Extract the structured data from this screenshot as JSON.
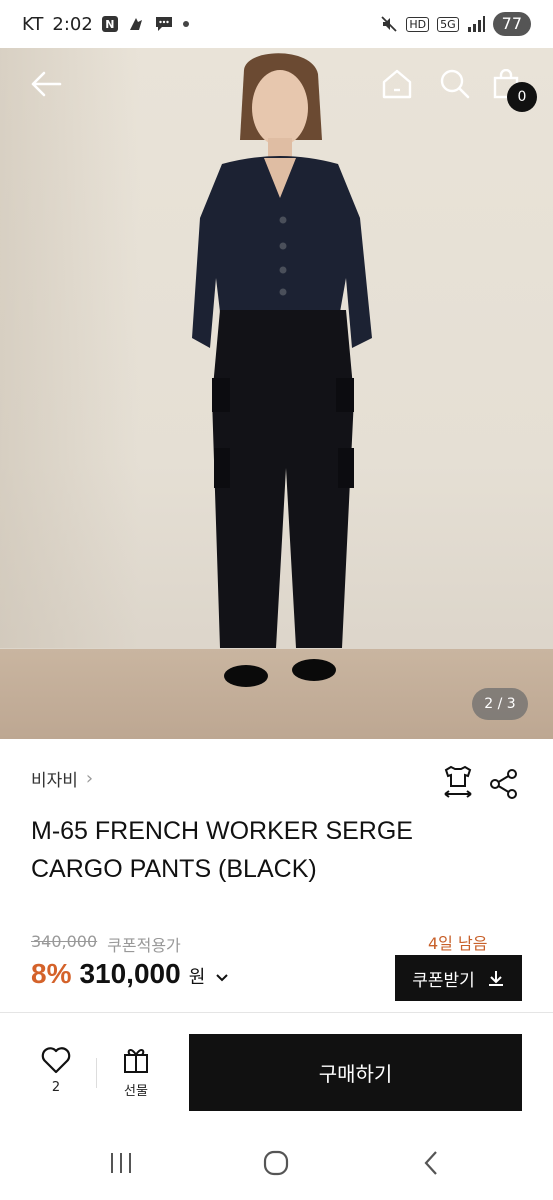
{
  "status_bar": {
    "carrier": "KT",
    "time": "2:02",
    "battery": "77",
    "hd_label": "HD",
    "net_label": "5G"
  },
  "hero": {
    "page_counter": "2 / 3",
    "cart_count": "0"
  },
  "product": {
    "brand": "비자비",
    "title": "M-65 FRENCH WORKER SERGE CARGO PANTS (BLACK)",
    "original_price": "340,000",
    "coupon_price_label": "쿠폰적용가",
    "days_left": "4일 남음",
    "discount": "8%",
    "price": "310,000",
    "currency": "원",
    "coupon_button": "쿠폰받기"
  },
  "bottom_bar": {
    "like_count": "2",
    "gift_label": "선물",
    "buy_button": "구매하기"
  },
  "colors": {
    "accent_orange": "#d4622a",
    "dark": "#111111"
  }
}
